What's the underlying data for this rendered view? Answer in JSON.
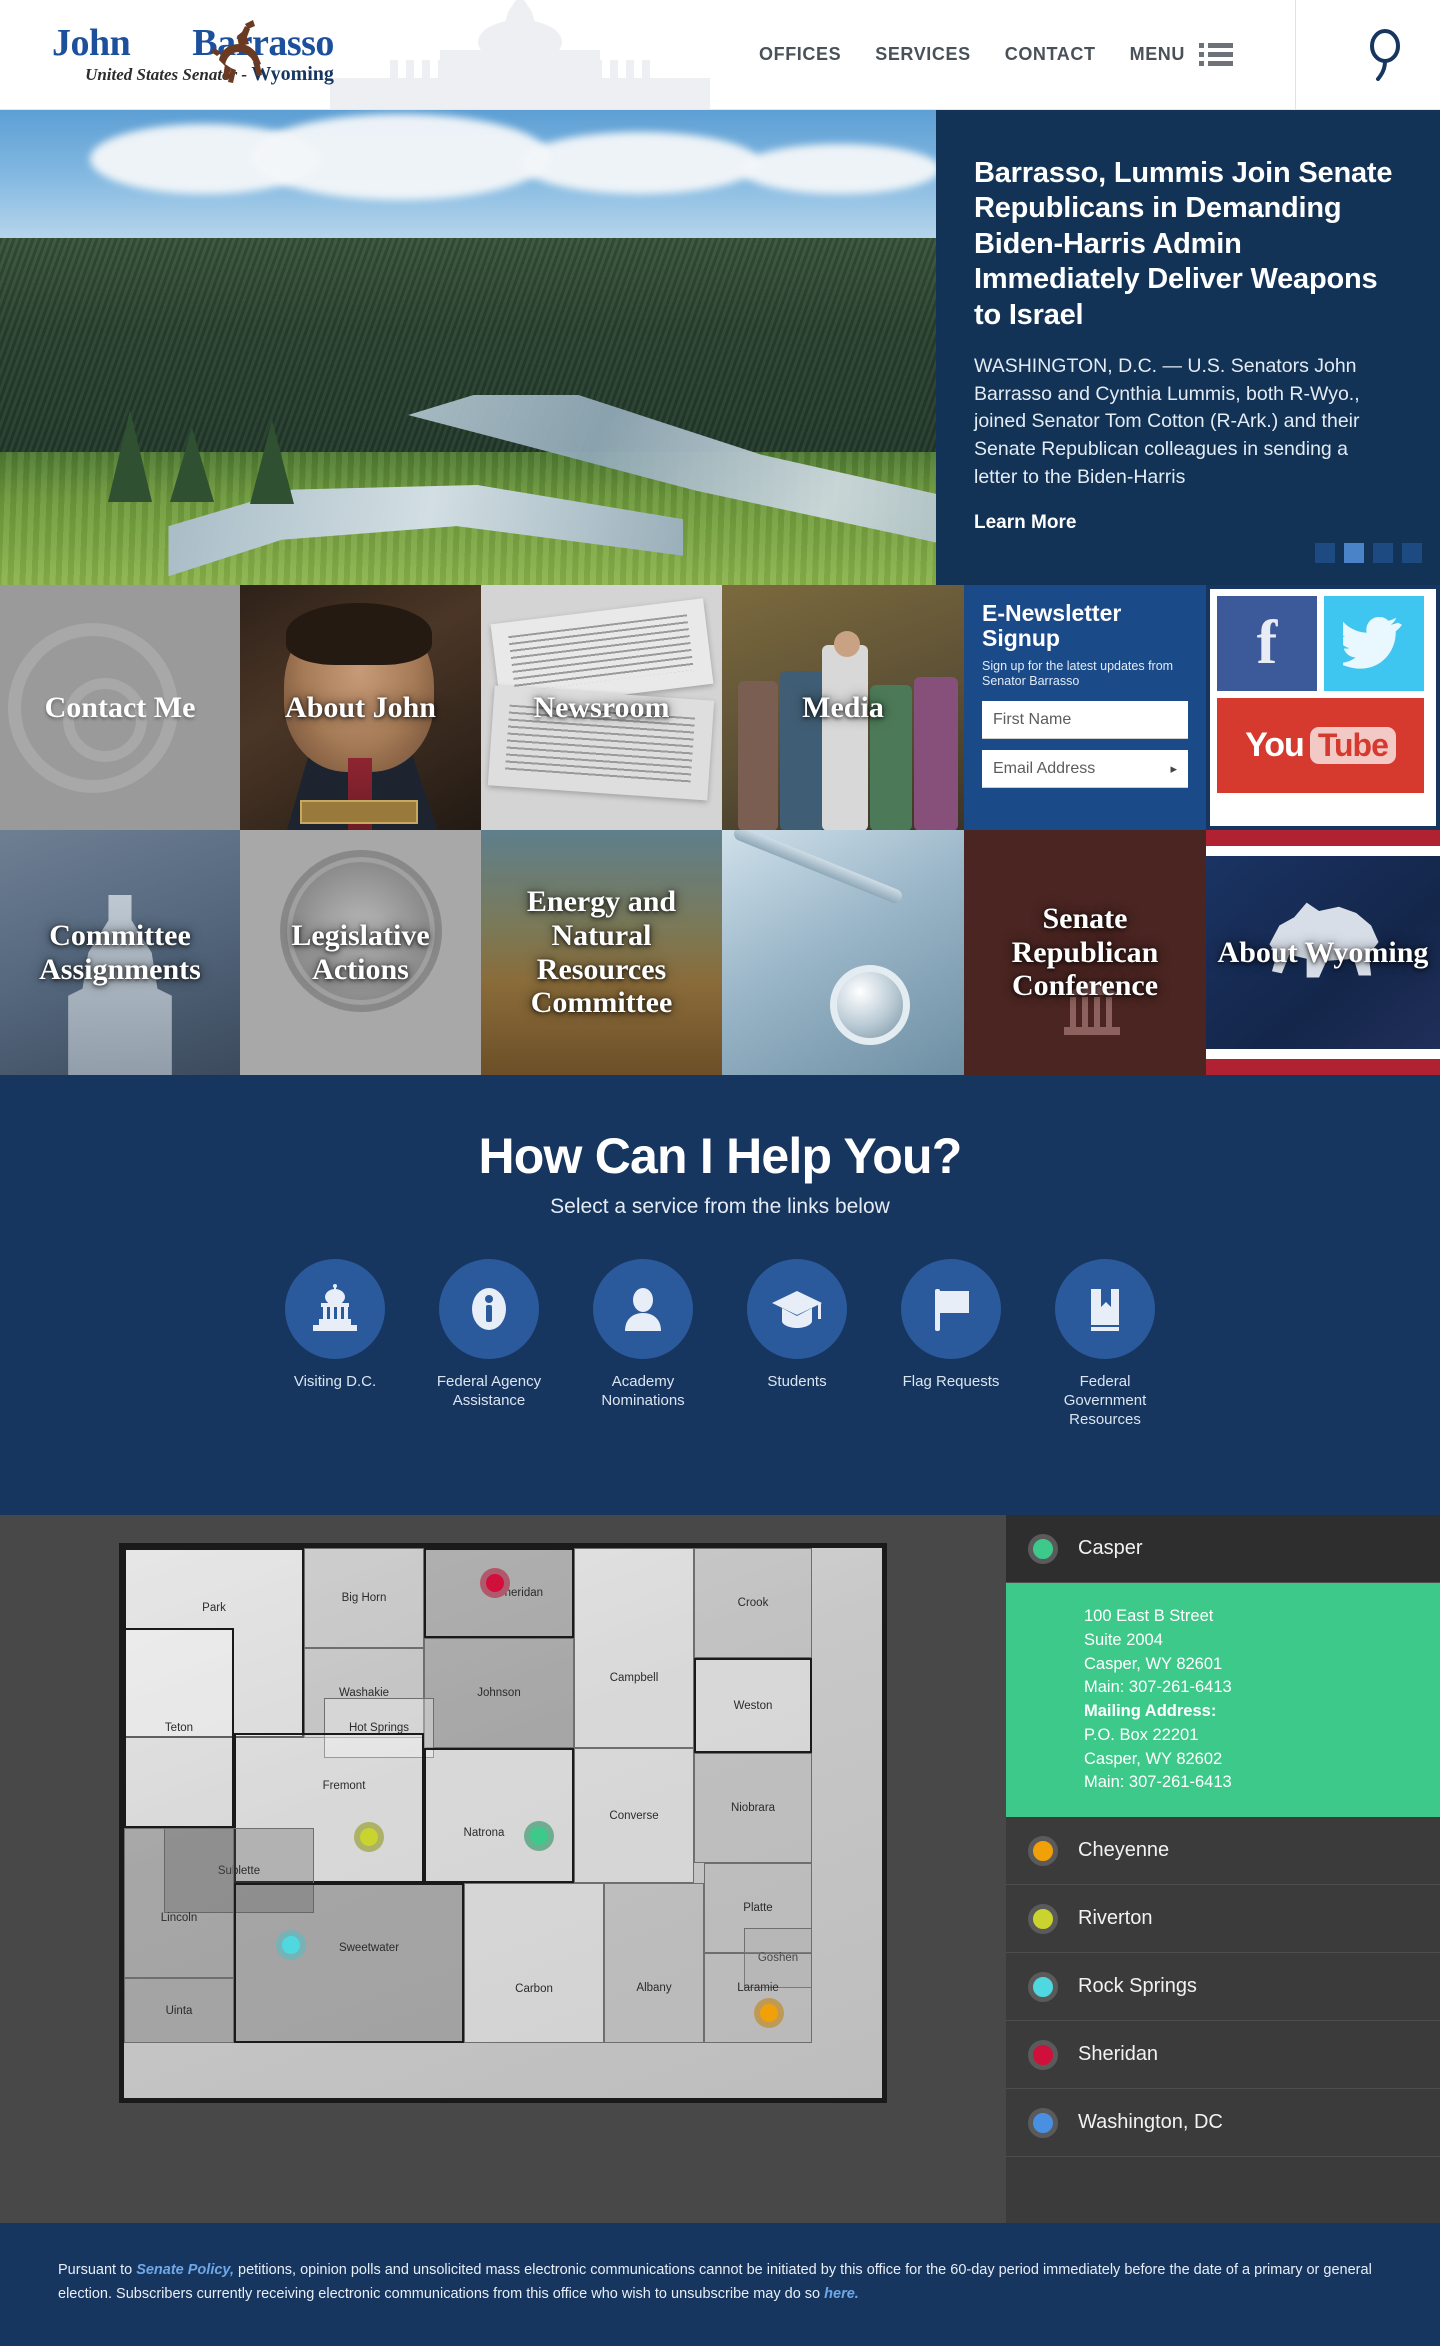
{
  "header": {
    "logo": {
      "first_name": "John",
      "last_name": "Barrasso",
      "tagline_prefix": "United States Senator - ",
      "tagline_state": "Wyoming",
      "horse_icon": "bucking-horse-icon",
      "capitol_icon": "capitol-dome-icon"
    },
    "nav": [
      {
        "label": "OFFICES"
      },
      {
        "label": "SERVICES"
      },
      {
        "label": "CONTACT"
      },
      {
        "label": "MENU"
      }
    ],
    "search_icon": "search-icon",
    "menu_icon": "hamburger-menu-icon"
  },
  "hero": {
    "title": "Barrasso, Lummis Join Senate Republicans in Demanding Biden-Harris Admin Immediately Deliver Weapons to Israel",
    "body": "WASHINGTON, D.C. — U.S. Senators John Barrasso and Cynthia Lummis, both R-Wyo., joined Senator Tom Cotton (R-Ark.) and their Senate Republican colleagues in sending a letter to the Biden-Harris",
    "link_label": "Learn More",
    "slide_count": 4,
    "active_slide": 2,
    "image_alt": "wyoming-mountain-river-landscape"
  },
  "tiles_row1": [
    {
      "label": "Contact Me",
      "name": "tile-contact-me"
    },
    {
      "label": "About John",
      "name": "tile-about-john"
    },
    {
      "label": "Newsroom",
      "name": "tile-newsroom"
    },
    {
      "label": "Media",
      "name": "tile-media"
    }
  ],
  "newsletter": {
    "title": "E-Newsletter Signup",
    "subtitle": "Sign up for the latest updates from Senator Barrasso",
    "first_name_placeholder": "First Name",
    "first_name_value": "",
    "email_placeholder": "Email Address",
    "email_value": "",
    "submit_arrow": "▸"
  },
  "social": [
    {
      "name": "facebook-icon",
      "label": "f",
      "color": "#3c5a9a"
    },
    {
      "name": "twitter-icon",
      "label": "",
      "color": "#3fc6f0"
    },
    {
      "name": "youtube-icon",
      "label_you": "You",
      "label_tube": "Tube",
      "color": "#d63a2f"
    }
  ],
  "tiles_row2": [
    {
      "label": "Committee Assignments",
      "name": "tile-committee-assignments"
    },
    {
      "label": "Legislative Actions",
      "name": "tile-legislative-actions"
    },
    {
      "label": "Energy and Natural Resources Committee",
      "name": "tile-energy-natural-resources"
    },
    {
      "label": "",
      "name": "tile-health"
    },
    {
      "label": "Senate Republican Conference",
      "name": "tile-senate-republican-conference"
    },
    {
      "label": "About Wyoming",
      "name": "tile-about-wyoming"
    }
  ],
  "help": {
    "title": "How Can I Help You?",
    "subtitle": "Select a service from the links below",
    "items": [
      {
        "label": "Visiting D.C.",
        "icon": "capitol-icon"
      },
      {
        "label": "Federal Agency Assistance",
        "icon": "info-icon"
      },
      {
        "label": "Academy Nominations",
        "icon": "person-icon"
      },
      {
        "label": "Students",
        "icon": "graduation-cap-icon"
      },
      {
        "label": "Flag Requests",
        "icon": "flag-icon"
      },
      {
        "label": "Federal Government Resources",
        "icon": "book-icon"
      }
    ]
  },
  "map": {
    "counties": [
      "Park",
      "Big Horn",
      "Sheridan",
      "Crook",
      "Teton",
      "Washakie",
      "Johnson",
      "Campbell",
      "Weston",
      "Hot Springs",
      "Fremont",
      "Natrona",
      "Converse",
      "Niobrara",
      "Sublette",
      "Lincoln",
      "Sweetwater",
      "Carbon",
      "Albany",
      "Platte",
      "Goshen",
      "Uinta",
      "Laramie"
    ],
    "pins": [
      {
        "city": "Sheridan",
        "color": "#d0103a"
      },
      {
        "city": "Riverton",
        "color": "#c9d42e"
      },
      {
        "city": "Casper",
        "color": "#3dc98a"
      },
      {
        "city": "Rock Springs",
        "color": "#4fd8e0"
      },
      {
        "city": "Cheyenne",
        "color": "#f2a007"
      }
    ]
  },
  "offices": [
    {
      "name": "Casper",
      "color": "#3dc98a",
      "expanded": true,
      "address": [
        {
          "text": "100 East B Street",
          "bold": false
        },
        {
          "text": "Suite 2004",
          "bold": false
        },
        {
          "text": "Casper, WY 82601",
          "bold": false
        },
        {
          "text": "Main: 307-261-6413",
          "bold": false
        },
        {
          "text": "Mailing Address:",
          "bold": true
        },
        {
          "text": "P.O. Box 22201",
          "bold": false
        },
        {
          "text": "Casper, WY 82602",
          "bold": false
        },
        {
          "text": "Main: 307-261-6413",
          "bold": false
        }
      ]
    },
    {
      "name": "Cheyenne",
      "color": "#f2a007",
      "expanded": false,
      "address": []
    },
    {
      "name": "Riverton",
      "color": "#c9d42e",
      "expanded": false,
      "address": []
    },
    {
      "name": "Rock Springs",
      "color": "#4fd8e0",
      "expanded": false,
      "address": []
    },
    {
      "name": "Sheridan",
      "color": "#d0103a",
      "expanded": false,
      "address": []
    },
    {
      "name": "Washington, DC",
      "color": "#4a90e2",
      "expanded": false,
      "address": []
    }
  ],
  "footer": {
    "part1": "Pursuant to ",
    "link1": "Senate Policy,",
    "part2": " petitions, opinion polls and unsolicited mass electronic communications cannot be initiated by this office for the 60-day period immediately before the date of a primary or general election. Subscribers currently receiving electronic communications from this office who wish to unsubscribe may do so ",
    "link2": "here."
  },
  "colors": {
    "brand_navy": "#16355f",
    "hero_panel": "#123256",
    "newsletter_blue": "#1b4a89",
    "help_circle": "#2a5a9c",
    "map_bg": "#484848",
    "office_panel": "#3b3b3b",
    "accent_green": "#3dc98a"
  }
}
